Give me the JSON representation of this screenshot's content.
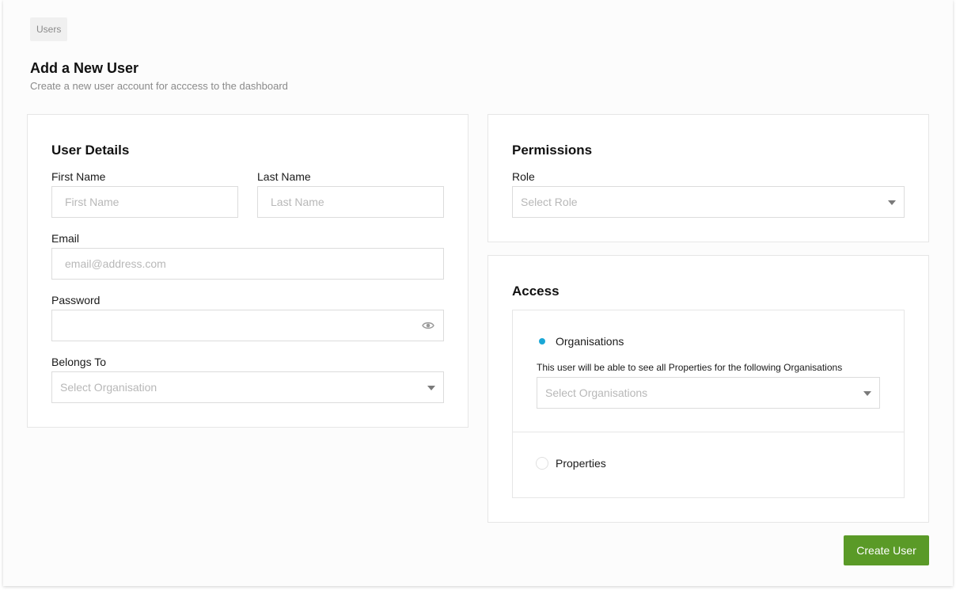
{
  "breadcrumb": {
    "label": "Users"
  },
  "header": {
    "title": "Add a New User",
    "subtitle": "Create a new user account for acccess to the dashboard"
  },
  "user_details": {
    "title": "User Details",
    "first_name": {
      "label": "First Name",
      "placeholder": "First Name",
      "value": ""
    },
    "last_name": {
      "label": "Last Name",
      "placeholder": "Last Name",
      "value": ""
    },
    "email": {
      "label": "Email",
      "placeholder": "email@address.com",
      "value": ""
    },
    "password": {
      "label": "Password",
      "value": "",
      "toggle_icon": "eye-icon"
    },
    "belongs_to": {
      "label": "Belongs To",
      "placeholder": "Select Organisation"
    }
  },
  "permissions": {
    "title": "Permissions",
    "role": {
      "label": "Role",
      "placeholder": "Select Role"
    }
  },
  "access": {
    "title": "Access",
    "options": [
      {
        "label": "Organisations",
        "selected": true,
        "helper": "This user will be able to see all Properties for the following Organisations",
        "select_placeholder": "Select Organisations"
      },
      {
        "label": "Properties",
        "selected": false
      }
    ]
  },
  "actions": {
    "create_label": "Create User"
  },
  "colors": {
    "accent": "#1aa7d6",
    "primary_button": "#5a9a27"
  }
}
